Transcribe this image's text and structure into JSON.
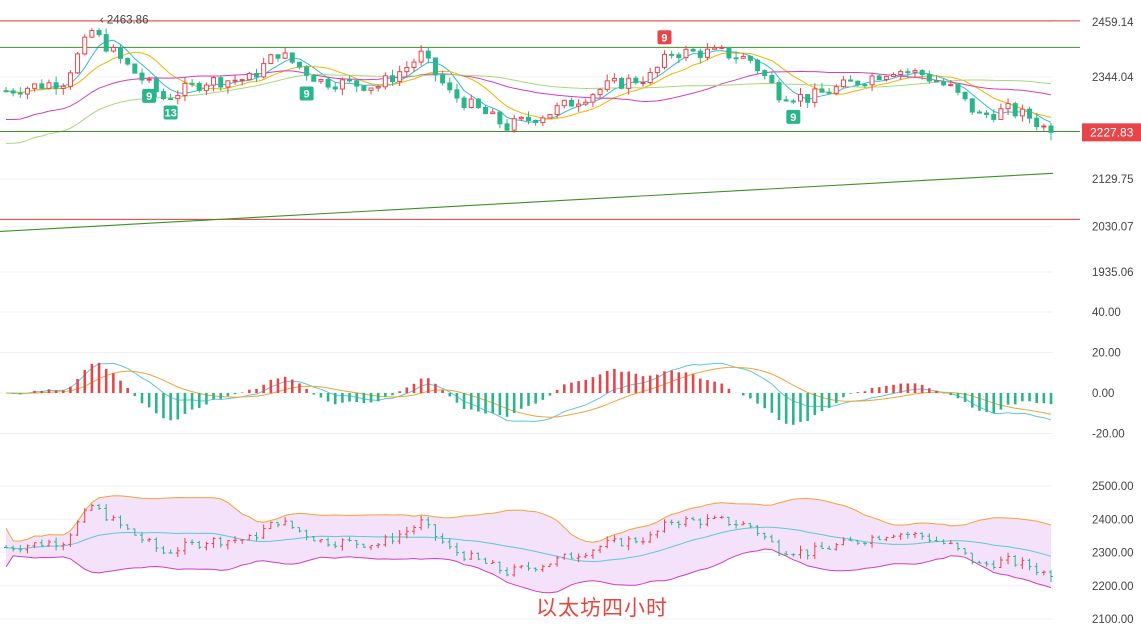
{
  "caption": "以太坊四小时",
  "colors": {
    "up": "#e8454b",
    "down": "#2bb58c",
    "hline_red": "#e03a3a",
    "hline_green": "#3f8f2a",
    "trend": "#3f8f2a",
    "ma_yellow": "#f4b400",
    "ma_cyan": "#3ab6d6",
    "ma_magenta": "#d23fbd",
    "ma_lightgreen": "#a6d97a",
    "macd_fast": "#5ec8d6",
    "macd_slow": "#f2a33a",
    "boll_upper": "#f2a33a",
    "boll_mid": "#5ec8d6",
    "boll_lower": "#d23fbd",
    "boll_fill": "#f3defa"
  },
  "chart_data": [
    {
      "type": "candlestick",
      "panel": "price",
      "y_ticks": [
        "2459.14",
        "2344.04",
        "2129.75",
        "2030.07",
        "1935.06"
      ],
      "y_tick_values": [
        2459.14,
        2344.04,
        2129.75,
        2030.07,
        1935.06
      ],
      "ylim": [
        1880,
        2478
      ],
      "last_price_label": "2227.83",
      "last_price": 2227.83,
      "high_marker_label": "2463.86",
      "high_marker": 2463.86,
      "horizontal_lines": [
        {
          "value": 2461.5,
          "color": "red"
        },
        {
          "value": 2406.0,
          "color": "green"
        },
        {
          "value": 2229.5,
          "color": "green"
        },
        {
          "value": 2045.5,
          "color": "red"
        }
      ],
      "trendline": {
        "start": 2020,
        "end": 2142
      },
      "td_markers": [
        {
          "index": 20,
          "label": "9",
          "side": "below"
        },
        {
          "index": 23,
          "label": "13",
          "side": "below"
        },
        {
          "index": 42,
          "label": "9",
          "side": "below"
        },
        {
          "index": 92,
          "label": "9",
          "side": "above"
        },
        {
          "index": 110,
          "label": "9",
          "side": "below"
        }
      ],
      "moving_averages": [
        "ma_yellow",
        "ma_cyan",
        "ma_magenta",
        "ma_lightgreen"
      ]
    },
    {
      "type": "macd",
      "panel": "macd",
      "y_ticks": [
        "40.00",
        "20.00",
        "0.00",
        "-20.00"
      ],
      "y_tick_values": [
        40,
        20,
        0,
        -20
      ],
      "ylim": [
        -30,
        45
      ],
      "series": [
        "macd_fast",
        "macd_slow",
        "histogram"
      ]
    },
    {
      "type": "bollinger",
      "panel": "boll",
      "y_ticks": [
        "2500.00",
        "2400.00",
        "2300.00",
        "2200.00",
        "2100.00"
      ],
      "y_tick_values": [
        2500,
        2400,
        2300,
        2200,
        2100
      ],
      "ylim": [
        2100,
        2500
      ],
      "series": [
        "boll_upper",
        "boll_mid",
        "boll_lower",
        "price_bars"
      ]
    }
  ]
}
